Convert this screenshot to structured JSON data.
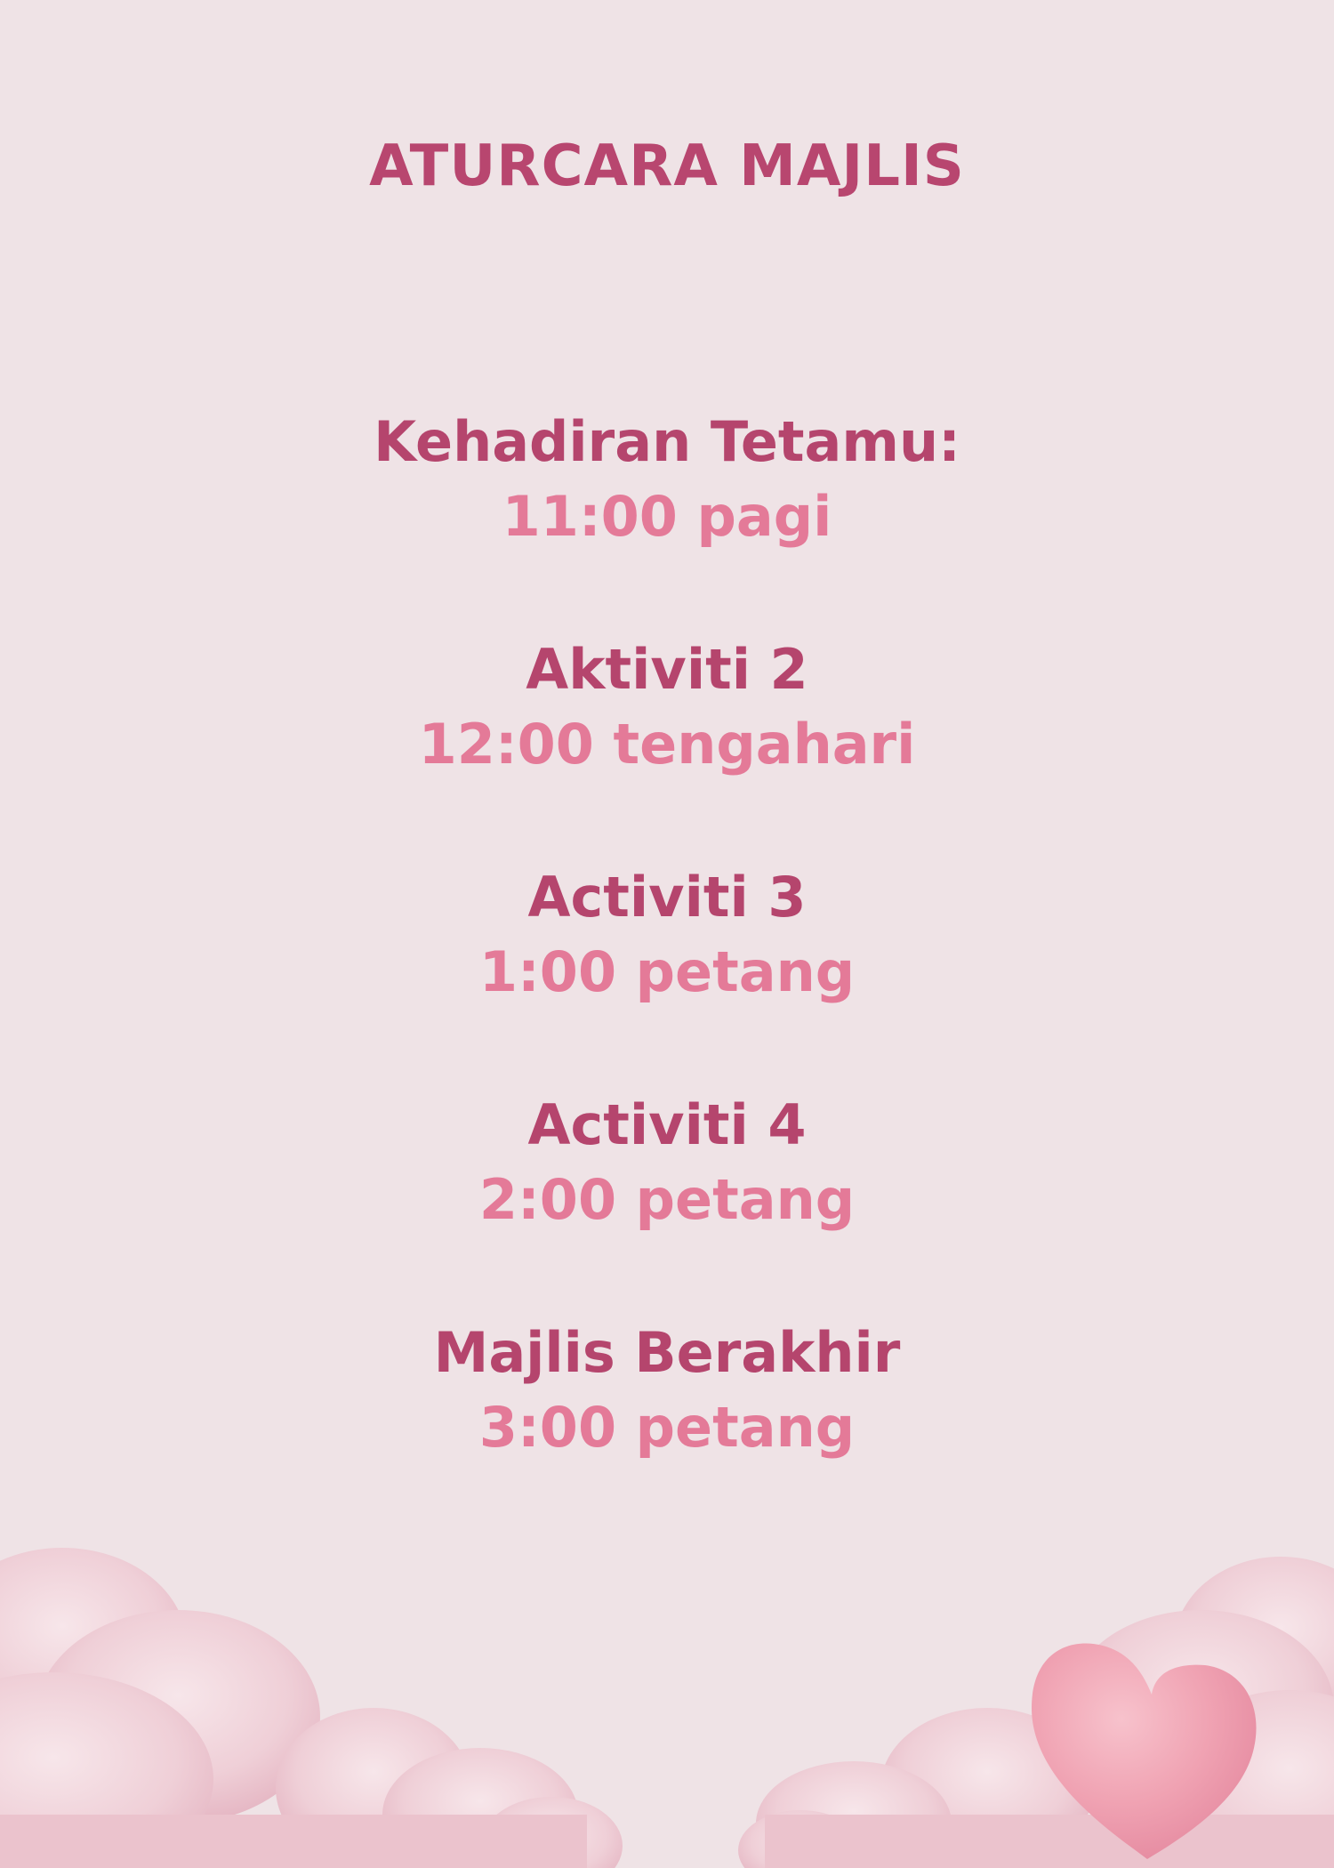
{
  "title": "ATURCARA MAJLIS",
  "schedule": [
    {
      "label": "Kehadiran Tetamu:",
      "time": "11:00 pagi"
    },
    {
      "label": "Aktiviti 2",
      "time": "12:00 tengahari"
    },
    {
      "label": "Activiti 3",
      "time": "1:00 petang"
    },
    {
      "label": "Activiti 4",
      "time": "2:00 petang"
    },
    {
      "label": "Majlis Berakhir",
      "time": "3:00 petang"
    }
  ],
  "colors": {
    "background": "#efe3e6",
    "heading": "#b5456d",
    "time": "#e47a98",
    "cloud": "#ecc6d0",
    "heart": "#f0a7b6"
  }
}
